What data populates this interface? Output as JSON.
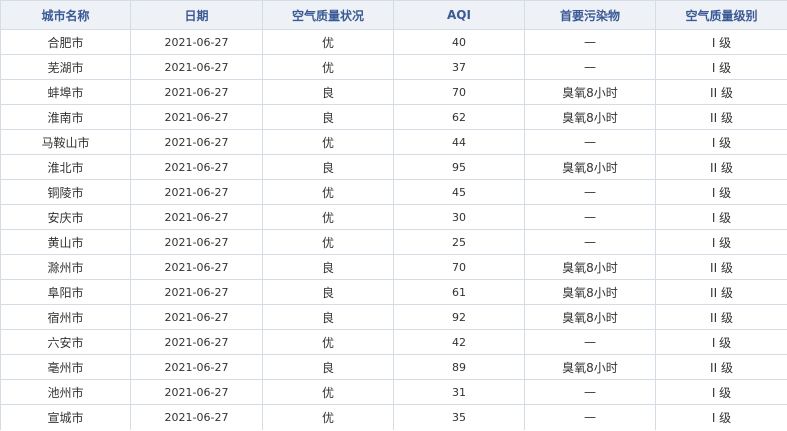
{
  "table": {
    "headers": [
      "城市名称",
      "日期",
      "空气质量状况",
      "AQI",
      "首要污染物",
      "空气质量级别"
    ],
    "rows": [
      [
        "合肥市",
        "2021-06-27",
        "优",
        "40",
        "—",
        "I 级"
      ],
      [
        "芜湖市",
        "2021-06-27",
        "优",
        "37",
        "—",
        "I 级"
      ],
      [
        "蚌埠市",
        "2021-06-27",
        "良",
        "70",
        "臭氧8小时",
        "II 级"
      ],
      [
        "淮南市",
        "2021-06-27",
        "良",
        "62",
        "臭氧8小时",
        "II 级"
      ],
      [
        "马鞍山市",
        "2021-06-27",
        "优",
        "44",
        "—",
        "I 级"
      ],
      [
        "淮北市",
        "2021-06-27",
        "良",
        "95",
        "臭氧8小时",
        "II 级"
      ],
      [
        "铜陵市",
        "2021-06-27",
        "优",
        "45",
        "—",
        "I 级"
      ],
      [
        "安庆市",
        "2021-06-27",
        "优",
        "30",
        "—",
        "I 级"
      ],
      [
        "黄山市",
        "2021-06-27",
        "优",
        "25",
        "—",
        "I 级"
      ],
      [
        "滁州市",
        "2021-06-27",
        "良",
        "70",
        "臭氧8小时",
        "II 级"
      ],
      [
        "阜阳市",
        "2021-06-27",
        "良",
        "61",
        "臭氧8小时",
        "II 级"
      ],
      [
        "宿州市",
        "2021-06-27",
        "良",
        "92",
        "臭氧8小时",
        "II 级"
      ],
      [
        "六安市",
        "2021-06-27",
        "优",
        "42",
        "—",
        "I 级"
      ],
      [
        "亳州市",
        "2021-06-27",
        "良",
        "89",
        "臭氧8小时",
        "II 级"
      ],
      [
        "池州市",
        "2021-06-27",
        "优",
        "31",
        "—",
        "I 级"
      ],
      [
        "宣城市",
        "2021-06-27",
        "优",
        "35",
        "—",
        "I 级"
      ]
    ]
  }
}
